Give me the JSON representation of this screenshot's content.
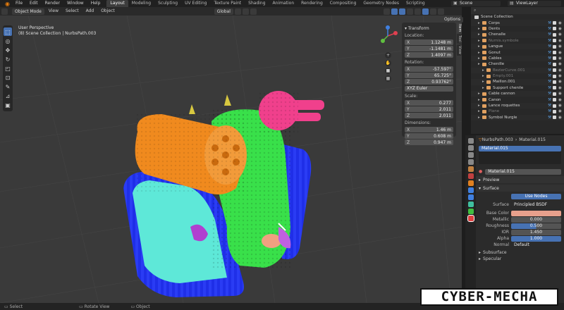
{
  "app": {
    "menus": [
      "File",
      "Edit",
      "Render",
      "Window",
      "Help"
    ],
    "workspaces": [
      "Layout",
      "Modeling",
      "Sculpting",
      "UV Editing",
      "Texture Paint",
      "Shading",
      "Animation",
      "Rendering",
      "Compositing",
      "Geometry Nodes",
      "Scripting"
    ],
    "scene": "Scene",
    "view_layer": "ViewLayer"
  },
  "viewport_header": {
    "mode": "Object Mode",
    "menus": [
      "View",
      "Select",
      "Add",
      "Object"
    ],
    "orientation": "Global",
    "options_label": "Options"
  },
  "viewport": {
    "perspective": "User Perspective",
    "object_info": "(8) Scene Collection | NurbsPath.003"
  },
  "npanel": {
    "section": "Transform",
    "location_label": "Location:",
    "location": [
      {
        "axis": "X",
        "value": "1.1248 m"
      },
      {
        "axis": "Y",
        "value": "-1.1481 m"
      },
      {
        "axis": "Z",
        "value": "1.4097 m"
      }
    ],
    "rotation_label": "Rotation:",
    "rotation": [
      {
        "axis": "X",
        "value": "-57.597°"
      },
      {
        "axis": "Y",
        "value": "65.725°"
      },
      {
        "axis": "Z",
        "value": "0.93762°"
      }
    ],
    "rotation_mode": "XYZ Euler",
    "scale_label": "Scale:",
    "scale": [
      {
        "axis": "X",
        "value": "0.277"
      },
      {
        "axis": "Y",
        "value": "2.011"
      },
      {
        "axis": "Z",
        "value": "2.011"
      }
    ],
    "dimensions_label": "Dimensions:",
    "dimensions": [
      {
        "axis": "X",
        "value": "1.46 m"
      },
      {
        "axis": "Y",
        "value": "0.608 m"
      },
      {
        "axis": "Z",
        "value": "0.947 m"
      }
    ],
    "tabs": [
      "Item",
      "Tool",
      "View"
    ]
  },
  "outliner": {
    "root": "Scene Collection",
    "rows": [
      {
        "name": "Corps",
        "dim": false,
        "indent": 1
      },
      {
        "name": "Dents",
        "dim": false,
        "indent": 1
      },
      {
        "name": "Chenalle",
        "dim": false,
        "indent": 1
      },
      {
        "name": "Nurnis.symbole",
        "dim": true,
        "indent": 1
      },
      {
        "name": "Langue",
        "dim": false,
        "indent": 1
      },
      {
        "name": "Gonut",
        "dim": false,
        "indent": 1
      },
      {
        "name": "Cables",
        "dim": false,
        "indent": 1
      },
      {
        "name": "Chenille",
        "dim": false,
        "indent": 1
      },
      {
        "name": "BezierCurve.001",
        "dim": true,
        "indent": 2
      },
      {
        "name": "Empty.001",
        "dim": true,
        "indent": 2
      },
      {
        "name": "Maillon.001",
        "dim": false,
        "indent": 2
      },
      {
        "name": "Support chenile",
        "dim": false,
        "indent": 2
      },
      {
        "name": "Cable cannon",
        "dim": false,
        "indent": 1
      },
      {
        "name": "Canon",
        "dim": false,
        "indent": 1
      },
      {
        "name": "Lance roquettes",
        "dim": false,
        "indent": 1
      },
      {
        "name": "Plane",
        "dim": true,
        "indent": 1
      },
      {
        "name": "Symbol Nurgle",
        "dim": false,
        "indent": 1
      }
    ]
  },
  "properties": {
    "object": "NurbsPath.003",
    "material": "Material.015",
    "slot": "Material.015",
    "material_field": "Material.015",
    "preview": "Preview",
    "surface": "Surface",
    "use_nodes": "Use Nodes",
    "surface_label": "Surface",
    "surface_value": "Principled BSDF",
    "base_color_label": "Base Color",
    "base_color": "#e8a08c",
    "metallic_label": "Metallic",
    "metallic": "0.000",
    "roughness_label": "Roughness",
    "roughness": "0.500",
    "ior_label": "IOR",
    "ior": "1.450",
    "alpha_label": "Alpha",
    "alpha": "1.000",
    "normal_label": "Normal",
    "normal": "Default",
    "subsurface": "Subsurface",
    "specular": "Specular"
  },
  "statusbar": [
    "Select",
    "Rotate View",
    "Object"
  ],
  "watermark": "CYBER-MECHA",
  "colors": {
    "accent": "#4772b3",
    "orange_cannon": "#f08a1e",
    "green_body": "#39e04a",
    "pink_launcher": "#f0408c",
    "blue_tracks": "#1f2fe8",
    "cyan_plate": "#5ee8d8"
  }
}
